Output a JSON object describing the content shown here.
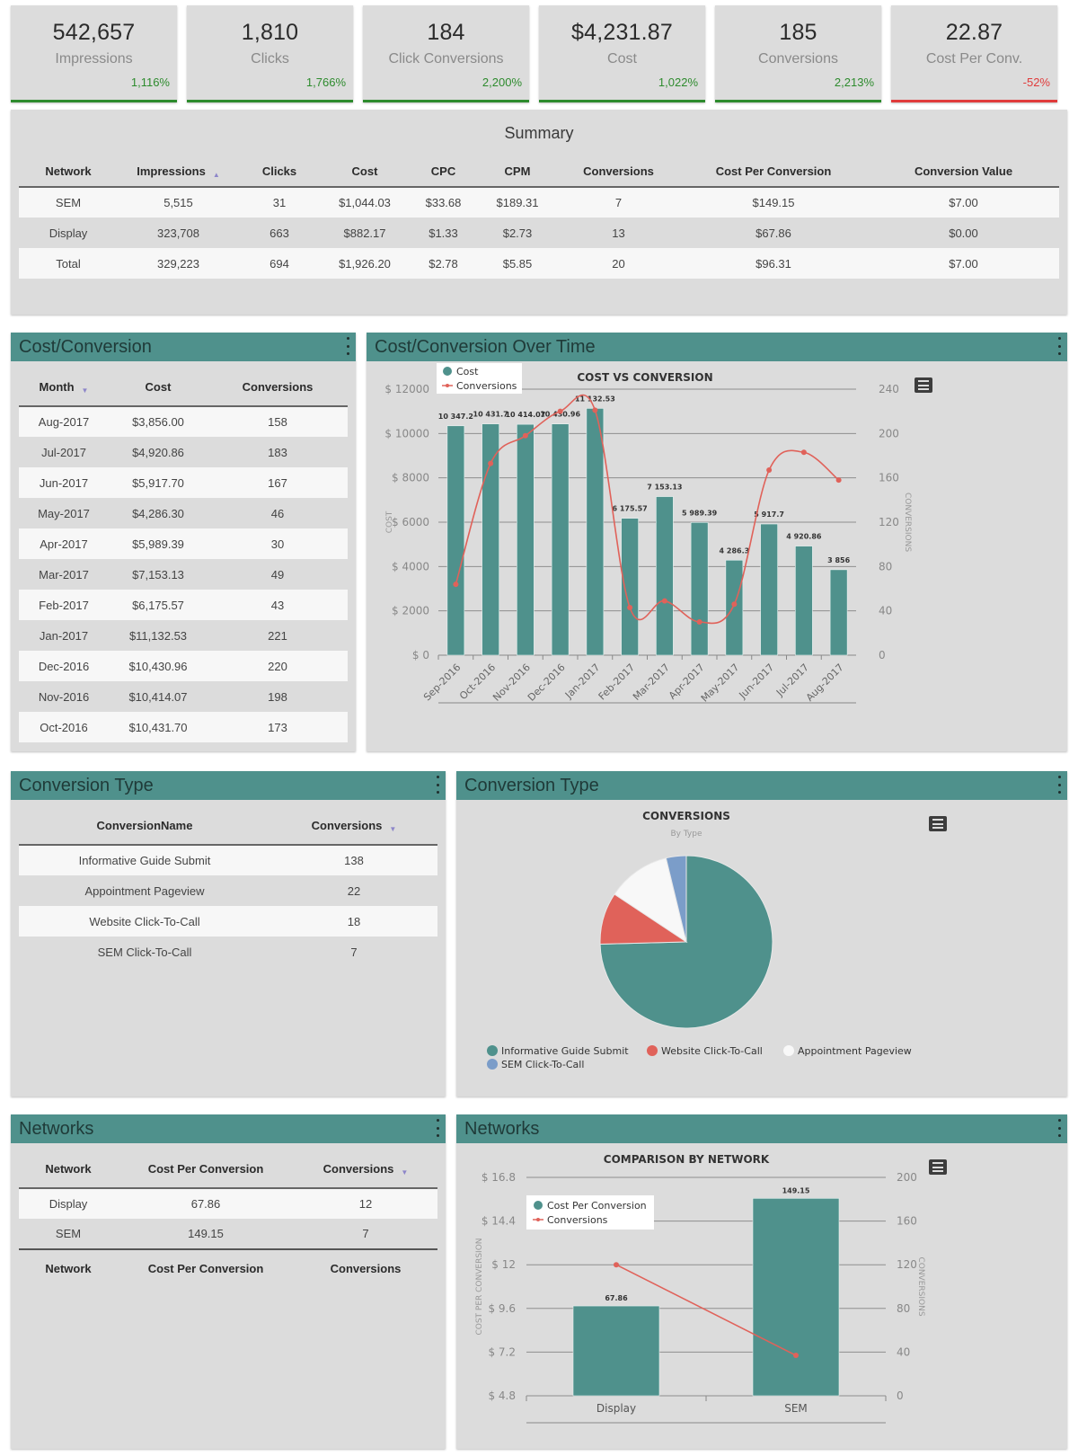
{
  "kpis": [
    {
      "value": "542,657",
      "label": "Impressions",
      "change": "1,116%",
      "trend": "up"
    },
    {
      "value": "1,810",
      "label": "Clicks",
      "change": "1,766%",
      "trend": "up"
    },
    {
      "value": "184",
      "label": "Click Conversions",
      "change": "2,200%",
      "trend": "up"
    },
    {
      "value": "$4,231.87",
      "label": "Cost",
      "change": "1,022%",
      "trend": "up"
    },
    {
      "value": "185",
      "label": "Conversions",
      "change": "2,213%",
      "trend": "up"
    },
    {
      "value": "22.87",
      "label": "Cost Per Conv.",
      "change": "-52%",
      "trend": "down"
    }
  ],
  "summary": {
    "title": "Summary",
    "columns": [
      "Network",
      "Impressions",
      "Clicks",
      "Cost",
      "CPC",
      "CPM",
      "Conversions",
      "Cost Per Conversion",
      "Conversion Value"
    ],
    "sort_icon": "sort-asc-icon",
    "rows": [
      [
        "SEM",
        "5,515",
        "31",
        "$1,044.03",
        "$33.68",
        "$189.31",
        "7",
        "$149.15",
        "$7.00"
      ],
      [
        "Display",
        "323,708",
        "663",
        "$882.17",
        "$1.33",
        "$2.73",
        "13",
        "$67.86",
        "$0.00"
      ],
      [
        "Total",
        "329,223",
        "694",
        "$1,926.20",
        "$2.78",
        "$5.85",
        "20",
        "$96.31",
        "$7.00"
      ]
    ]
  },
  "cost_conversion_table": {
    "title": "Cost/Conversion",
    "columns": [
      "Month",
      "Cost",
      "Conversions"
    ],
    "rows": [
      [
        "Aug-2017",
        "$3,856.00",
        "158"
      ],
      [
        "Jul-2017",
        "$4,920.86",
        "183"
      ],
      [
        "Jun-2017",
        "$5,917.70",
        "167"
      ],
      [
        "May-2017",
        "$4,286.30",
        "46"
      ],
      [
        "Apr-2017",
        "$5,989.39",
        "30"
      ],
      [
        "Mar-2017",
        "$7,153.13",
        "49"
      ],
      [
        "Feb-2017",
        "$6,175.57",
        "43"
      ],
      [
        "Jan-2017",
        "$11,132.53",
        "221"
      ],
      [
        "Dec-2016",
        "$10,430.96",
        "220"
      ],
      [
        "Nov-2016",
        "$10,414.07",
        "198"
      ],
      [
        "Oct-2016",
        "$10,431.70",
        "173"
      ]
    ]
  },
  "cost_over_time": {
    "panel_title": "Cost/Conversion Over Time"
  },
  "conversion_type_table": {
    "title": "Conversion Type",
    "columns": [
      "ConversionName",
      "Conversions"
    ],
    "rows": [
      [
        "Informative Guide Submit",
        "138"
      ],
      [
        "Appointment Pageview",
        "22"
      ],
      [
        "Website Click-To-Call",
        "18"
      ],
      [
        "SEM Click-To-Call",
        "7"
      ]
    ]
  },
  "conversion_type_chart": {
    "panel_title": "Conversion Type"
  },
  "networks_table": {
    "title": "Networks",
    "columns": [
      "Network",
      "Cost Per Conversion",
      "Conversions"
    ],
    "rows": [
      [
        "Display",
        "67.86",
        "12"
      ],
      [
        "SEM",
        "149.15",
        "7"
      ]
    ],
    "footer": [
      "Network",
      "Cost Per Conversion",
      "Conversions"
    ]
  },
  "networks_chart": {
    "panel_title": "Networks"
  },
  "colors": {
    "teal": "#4f918c",
    "red": "#e0625a",
    "white": "#f8f8f8",
    "blue": "#7b9dc9",
    "up": "#2e8b2e",
    "down": "#e03b3b"
  },
  "chart_data": [
    {
      "type": "bar",
      "title": "COST VS CONVERSION",
      "categories": [
        "Sep-2016",
        "Oct-2016",
        "Nov-2016",
        "Dec-2016",
        "Jan-2017",
        "Feb-2017",
        "Mar-2017",
        "Apr-2017",
        "May-2017",
        "Jun-2017",
        "Jul-2017",
        "Aug-2017"
      ],
      "series": [
        {
          "name": "Cost",
          "type": "bar",
          "axis": "left",
          "values": [
            10347.2,
            10431.7,
            10414.07,
            10430.96,
            11132.53,
            6175.57,
            7153.13,
            5989.39,
            4286.3,
            5917.7,
            4920.86,
            3856
          ],
          "labels": [
            "10 347.2",
            "10 431.7",
            "10 414.07",
            "10 430.96",
            "11 132.53",
            "6 175.57",
            "7 153.13",
            "5 989.39",
            "4 286.3",
            "5 917.7",
            "4 920.86",
            "3 856"
          ]
        },
        {
          "name": "Conversions",
          "type": "line",
          "axis": "right",
          "values": [
            64,
            173,
            198,
            220,
            221,
            43,
            49,
            30,
            46,
            167,
            183,
            158
          ]
        }
      ],
      "ylabel": "COST",
      "y2label": "CONVERSIONS",
      "ylim": [
        0,
        12000
      ],
      "y2lim": [
        0,
        240
      ],
      "yticks": [
        "$ 0",
        "$ 2000",
        "$ 4000",
        "$ 6000",
        "$ 8000",
        "$ 10000",
        "$ 12000"
      ],
      "y2ticks": [
        "0",
        "40",
        "80",
        "120",
        "160",
        "200",
        "240"
      ],
      "legend": "top-left",
      "grid": true
    },
    {
      "type": "pie",
      "title": "CONVERSIONS",
      "subtitle": "By Type",
      "categories": [
        "Informative Guide Submit",
        "Website Click-To-Call",
        "Appointment Pageview",
        "SEM Click-To-Call"
      ],
      "values": [
        138,
        18,
        22,
        7
      ],
      "legend": "bottom"
    },
    {
      "type": "bar",
      "title": "COMPARISON BY NETWORK",
      "categories": [
        "Display",
        "SEM"
      ],
      "series": [
        {
          "name": "Cost Per Conversion",
          "type": "bar",
          "axis": "left",
          "values": [
            67.86,
            149.15
          ],
          "labels": [
            "67.86",
            "149.15"
          ]
        },
        {
          "name": "Conversions",
          "type": "line",
          "axis": "right",
          "values": [
            120,
            37
          ]
        }
      ],
      "ylabel": "COST PER CONVERSION",
      "y2label": "CONVERSIONS",
      "yticks": [
        "$ 4.8",
        "$ 7.2",
        "$ 9.6",
        "$ 12",
        "$ 14.4",
        "$ 16.8"
      ],
      "y2ticks": [
        "0",
        "40",
        "80",
        "120",
        "160",
        "200"
      ],
      "y2lim": [
        0,
        200
      ],
      "legend": "top-left",
      "grid": true
    }
  ]
}
